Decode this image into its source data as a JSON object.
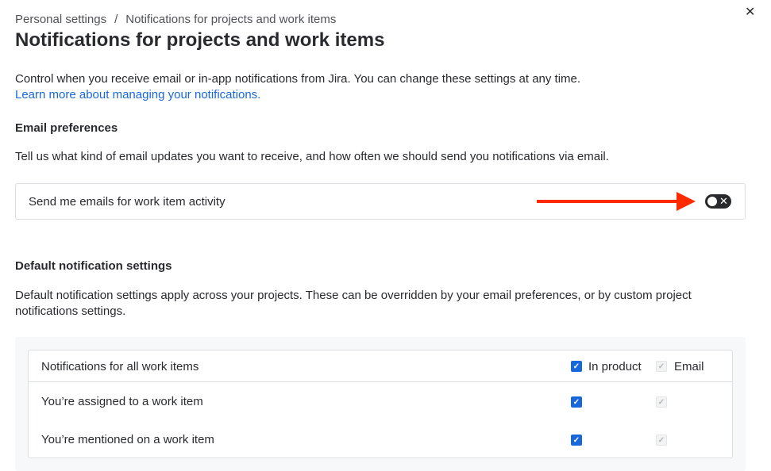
{
  "breadcrumb": {
    "parent": "Personal settings",
    "separator": "/",
    "current": "Notifications for projects and work items"
  },
  "title": "Notifications for projects and work items",
  "intro": "Control when you receive email or in-app notifications from Jira. You can change these settings at any time.",
  "learn_more": "Learn more about managing your notifications.",
  "email": {
    "heading": "Email preferences",
    "description": "Tell us what kind of email updates you want to receive, and how often we should send you notifications via email.",
    "toggle_label": "Send me emails for work item activity",
    "toggle_on": false,
    "toggle_icon": "✕"
  },
  "defaults": {
    "heading": "Default notification settings",
    "description": "Default notification settings apply across your projects. These can be overridden by your email preferences, or by custom project notifications settings.",
    "header": {
      "label": "Notifications for all work items",
      "in_product": "In product",
      "email": "Email"
    },
    "rows": [
      {
        "label": "You’re assigned to a work item",
        "in_product": true,
        "email": true
      },
      {
        "label": "You’re mentioned on a work item",
        "in_product": true,
        "email": true
      }
    ]
  },
  "colors": {
    "accent": "#1868db",
    "arrow": "#ff2a00"
  }
}
